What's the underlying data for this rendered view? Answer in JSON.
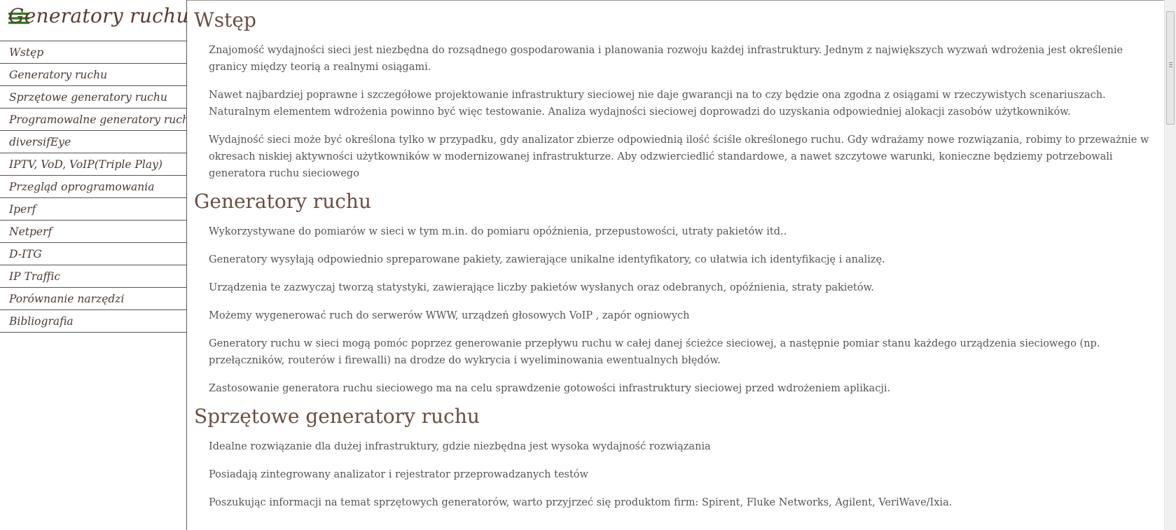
{
  "site": {
    "title": "Generatory ruchu",
    "logo_icon": "green-striped-logo-icon"
  },
  "colors": {
    "title_brown": "#5b3a2e",
    "heading_brown": "#6b4e42",
    "text_gray": "#555555",
    "logo_green": "#2e7d1e"
  },
  "nav": {
    "items": [
      {
        "label": "Wstęp"
      },
      {
        "label": "Generatory ruchu"
      },
      {
        "label": "Sprzętowe generatory ruchu"
      },
      {
        "label": "Programowalne generatory ruchu"
      },
      {
        "label": "diversifEye"
      },
      {
        "label": "IPTV, VoD, VoIP(Triple Play)"
      },
      {
        "label": "Przegląd oprogramowania"
      },
      {
        "label": "Iperf"
      },
      {
        "label": "Netperf"
      },
      {
        "label": "D-ITG"
      },
      {
        "label": "IP Traffic"
      },
      {
        "label": "Porównanie narzędzi"
      },
      {
        "label": "Bibliografia"
      }
    ]
  },
  "sections": [
    {
      "heading": "Wstęp",
      "paragraphs": [
        "Znajomość wydajności sieci jest niezbędna do rozsądnego gospodarowania i planowania rozwoju każdej infrastruktury. Jednym z największych wyzwań wdrożenia jest określenie granicy między teorią a realnymi osiągami.",
        "Nawet najbardziej poprawne i szczegółowe projektowanie infrastruktury sieciowej nie daje gwarancji na to czy będzie ona zgodna z osiągami w rzeczywistych scenariuszach. Naturalnym elementem wdrożenia powinno być więc testowanie. Analiza wydajności sieciowej doprowadzi do uzyskania odpowiedniej alokacji zasobów użytkowników.",
        "Wydajność sieci może być określona tylko w przypadku, gdy analizator zbierze odpowiednią ilość ściśle określonego ruchu. Gdy wdrażamy nowe rozwiązania, robimy to przeważnie w okresach niskiej aktywności użytkowników w modernizowanej infrastrukturze. Aby odzwierciedlić standardowe, a nawet szczytowe warunki, konieczne będziemy potrzebowali generatora ruchu sieciowego"
      ]
    },
    {
      "heading": "Generatory ruchu",
      "paragraphs": [
        "Wykorzystywane do pomiarów w sieci w tym m.in. do pomiaru opóźnienia, przepustowości, utraty pakietów itd..",
        "Generatory wysyłają odpowiednio spreparowane pakiety, zawierające unikalne identyfikatory, co ułatwia ich identyfikację i analizę.",
        "Urządzenia te zazwyczaj tworzą statystyki, zawierające liczby pakietów wysłanych oraz odebranych, opóźnienia, straty pakietów.",
        "Możemy wygenerować ruch do serwerów WWW, urządzeń głosowych VoIP , zapór ogniowych",
        "Generatory ruchu w sieci mogą pomóc poprzez generowanie przepływu ruchu w całej danej ścieżce sieciowej, a następnie pomiar stanu każdego urządzenia sieciowego (np. przełączników, routerów i firewalli) na drodze do wykrycia i wyeliminowania ewentualnych błędów.",
        "Zastosowanie generatora ruchu sieciowego ma na celu sprawdzenie gotowości infrastruktury sieciowej przed wdrożeniem aplikacji."
      ]
    },
    {
      "heading": "Sprzętowe generatory ruchu",
      "paragraphs": [
        "Idealne rozwiązanie dla dużej infrastruktury, gdzie niezbędna jest wysoka wydajność rozwiązania",
        "Posiadają zintegrowany analizator i rejestrator przeprowadzanych testów",
        "Poszukując informacji na temat sprzętowych generatorów, warto przyjrzeć się produktom firm: Spirent, Fluke Networks, Agilent, VeriWave/Ixia."
      ]
    }
  ]
}
